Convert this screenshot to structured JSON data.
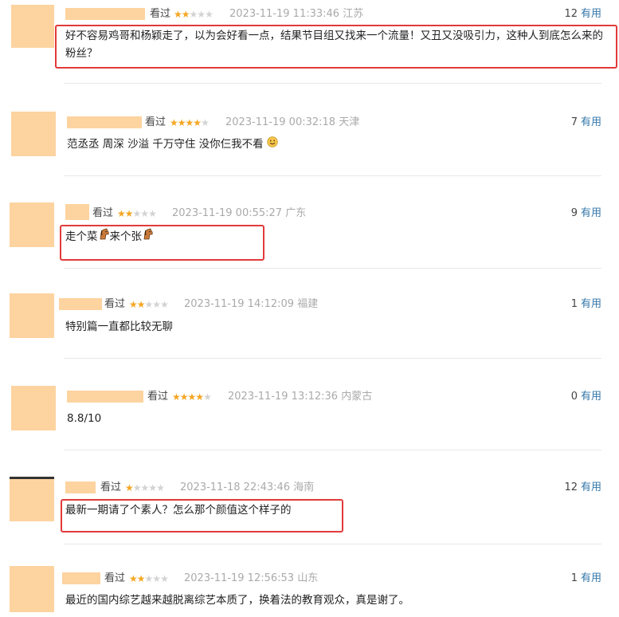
{
  "reviews": [
    {
      "status": "看过",
      "stars_on": 2,
      "time": "2023-11-19 11:33:46",
      "location": "江苏",
      "count": "12",
      "useful": "有用",
      "text": "好不容易鸡哥和杨颖走了，以为会好看一点，结果节目组又找来一个流量！又丑又没吸引力，这种人到底怎么来的粉丝？"
    },
    {
      "status": "看过",
      "stars_on": 4,
      "time": "2023-11-19 00:32:18",
      "location": "天津",
      "count": "7",
      "useful": "有用",
      "text": "范丞丞 周深 沙溢 千万守住 没你仨我不看"
    },
    {
      "status": "看过",
      "stars_on": 2,
      "time": "2023-11-19 00:55:27",
      "location": "广东",
      "count": "9",
      "useful": "有用",
      "text_a": "走个菜",
      "text_b": "来个张"
    },
    {
      "status": "看过",
      "stars_on": 2,
      "time": "2023-11-19 14:12:09",
      "location": "福建",
      "count": "1",
      "useful": "有用",
      "text": "特别篇一直都比较无聊"
    },
    {
      "status": "看过",
      "stars_on": 4,
      "time": "2023-11-19 13:12:36",
      "location": "内蒙古",
      "count": "0",
      "useful": "有用",
      "text": "8.8/10"
    },
    {
      "status": "看过",
      "stars_on": 1,
      "time": "2023-11-18 22:43:46",
      "location": "海南",
      "count": "12",
      "useful": "有用",
      "text": "最新一期请了个素人？怎么那个颜值这个样子的"
    },
    {
      "status": "看过",
      "stars_on": 2,
      "time": "2023-11-19 12:56:53",
      "location": "山东",
      "count": "1",
      "useful": "有用",
      "text": "最近的国内综艺越来越脱离综艺本质了，换着法的教育观众，真是谢了。"
    }
  ],
  "colors": {
    "accent_link": "#3377aa",
    "star_on": "#f5a623",
    "highlight": "#e23a3a",
    "avatar_placeholder": "#fdd3a0"
  },
  "icons": {
    "emoji_smile": "smiling-face-icon",
    "emoji_horse": "horse-face-icon"
  }
}
